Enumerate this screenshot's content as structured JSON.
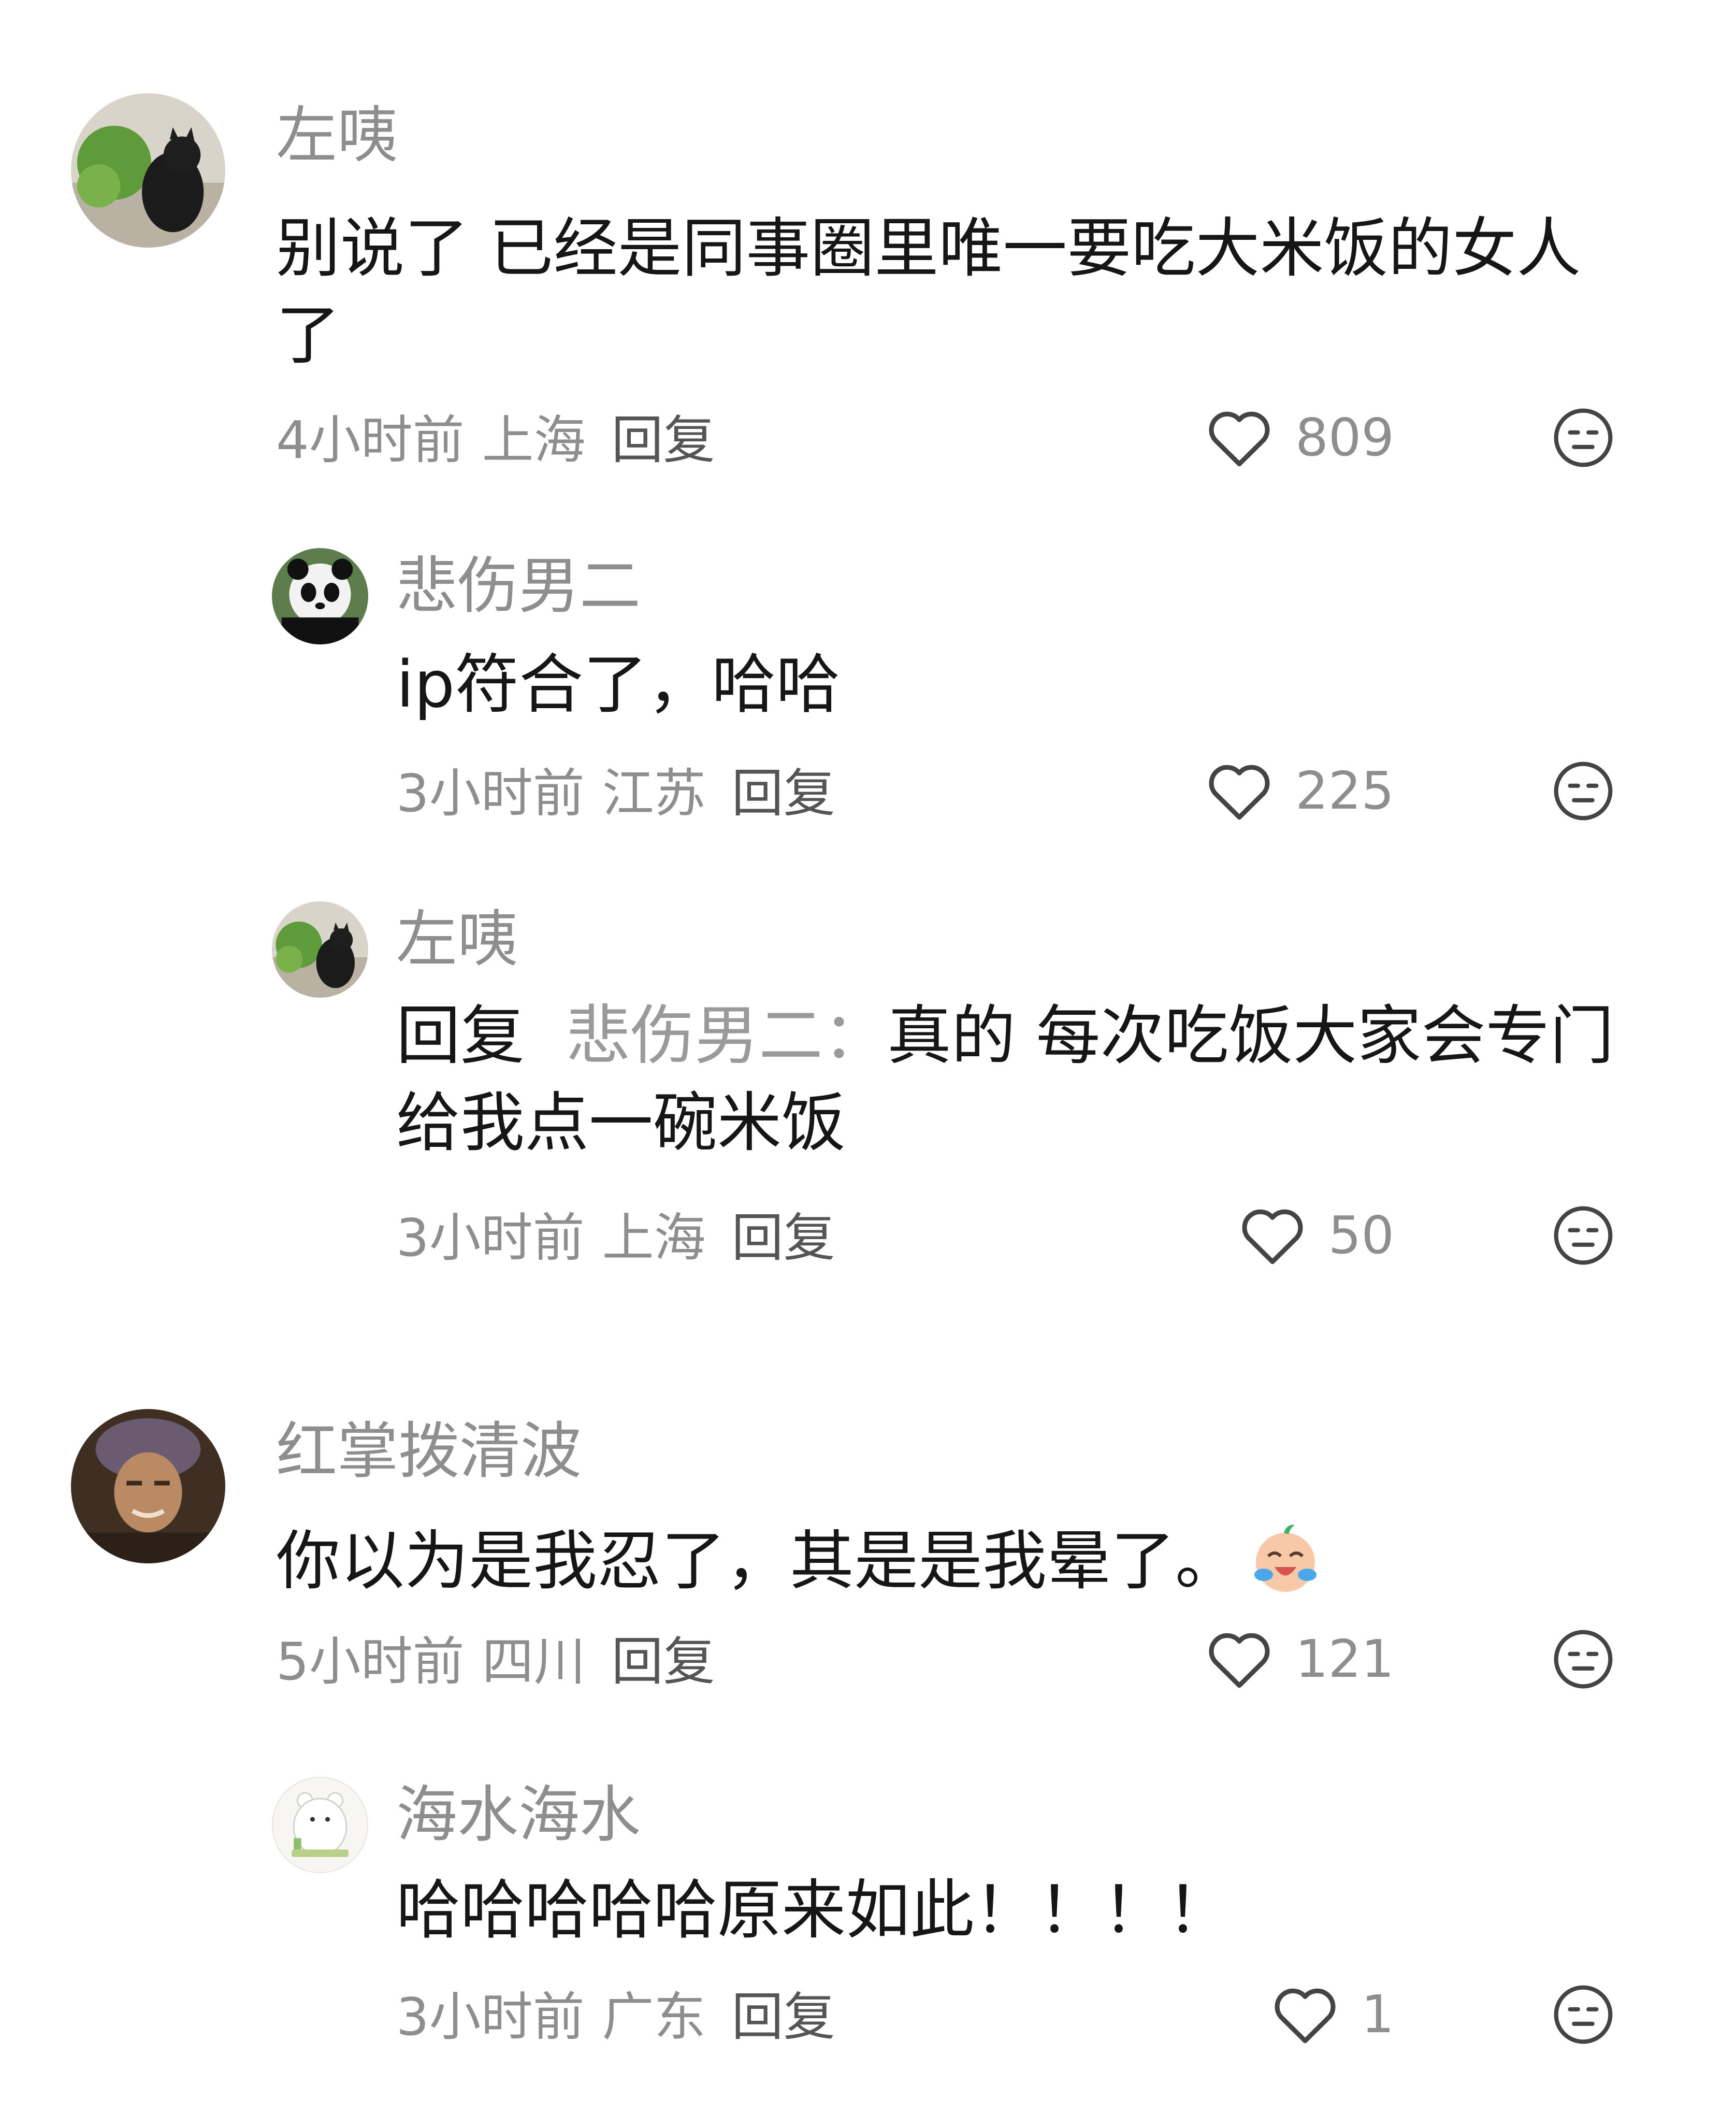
{
  "comments": [
    {
      "author": "左咦",
      "text": "别说了 已经是同事圈里唯一要吃大米饭的女人了",
      "time": "4小时前",
      "location": "上海",
      "reply_label": "回复",
      "likes": "809"
    },
    {
      "author": "悲伤男二",
      "text": "ip符合了，哈哈",
      "time": "3小时前",
      "location": "江苏",
      "reply_label": "回复",
      "likes": "225"
    },
    {
      "author": "左咦",
      "reply_prefix": "回复",
      "reply_target": "悲伤男二：",
      "text": "真的 每次吃饭大家会专门给我点一碗米饭",
      "time": "3小时前",
      "location": "上海",
      "reply_label": "回复",
      "likes": "50"
    },
    {
      "author": "红掌拨清波",
      "text": "你以为是我忍了，其是是我晕了。",
      "emoji": "crying-laughing-emoji",
      "time": "5小时前",
      "location": "四川",
      "reply_label": "回复",
      "likes": "121"
    },
    {
      "author": "海水海水",
      "text": "哈哈哈哈哈原来如此！！！！",
      "time": "3小时前",
      "location": "广东",
      "reply_label": "回复",
      "likes": "1"
    }
  ],
  "colors": {
    "secondary_text": "#8e8e8e",
    "primary_text": "#161616",
    "icon_stroke": "#444444"
  }
}
